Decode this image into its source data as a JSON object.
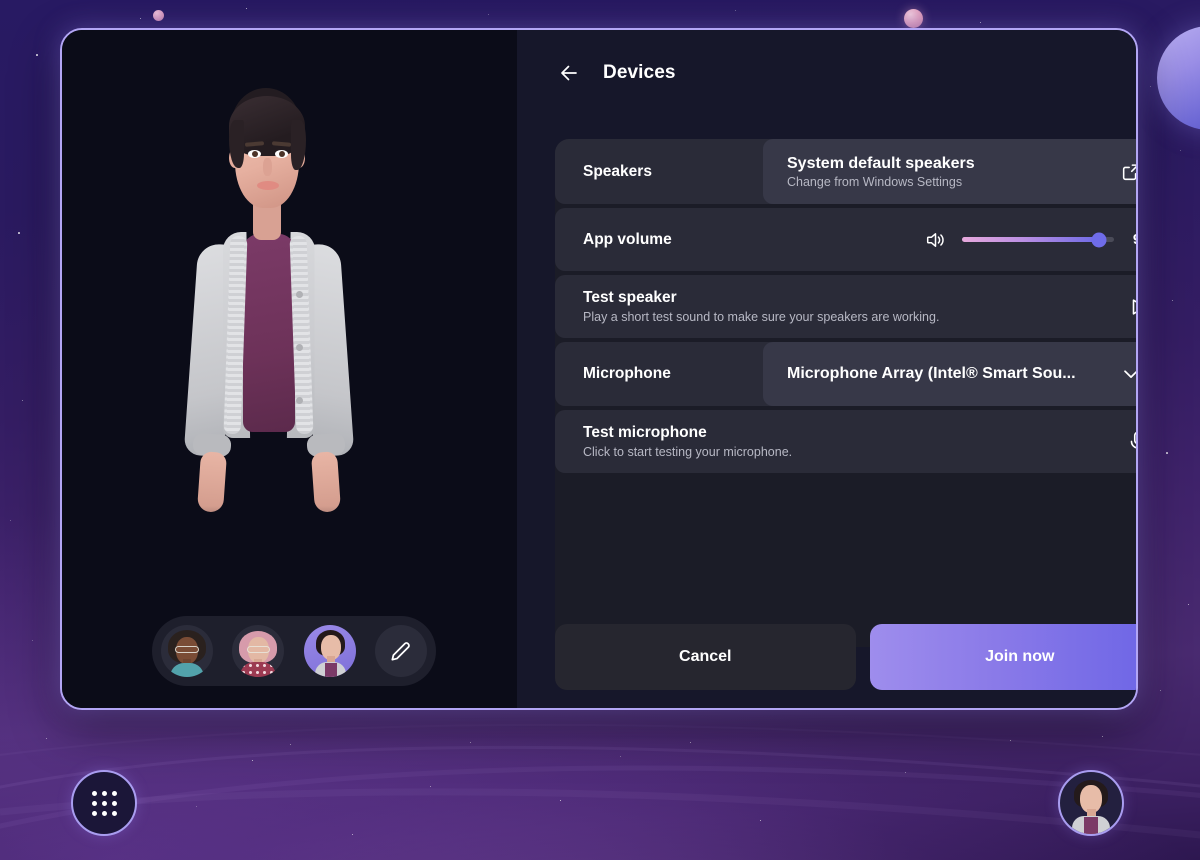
{
  "window": {
    "accent_purple": "#8a7ae8",
    "border_color": "#b3a6f5"
  },
  "stage": {
    "avatar_alt": "3D avatar preview",
    "picker": {
      "avatars": [
        {
          "name": "avatar-option-1",
          "selected": false
        },
        {
          "name": "avatar-option-2",
          "selected": false
        },
        {
          "name": "avatar-option-3",
          "selected": true
        }
      ],
      "edit_icon": "pencil-icon"
    }
  },
  "settings": {
    "back_icon": "arrow-left-icon",
    "title": "Devices",
    "rows": {
      "speakers": {
        "label": "Speakers",
        "value": "System default speakers",
        "description": "Change from Windows Settings",
        "action_icon": "external-link-icon"
      },
      "app_volume": {
        "label": "App volume",
        "icon": "speaker-volume-icon",
        "value": 9,
        "min": 0,
        "max": 10,
        "percent": 90
      },
      "test_speaker": {
        "title": "Test speaker",
        "description": "Play a short test sound to make sure your speakers are working.",
        "action_icon": "play-icon"
      },
      "microphone": {
        "label": "Microphone",
        "value": "Microphone Array (Intel® Smart Sou...",
        "action_icon": "chevron-down-icon"
      },
      "test_microphone": {
        "title": "Test microphone",
        "description": "Click to start testing your microphone.",
        "action_icon": "microphone-test-icon"
      }
    },
    "footer": {
      "cancel_label": "Cancel",
      "join_label": "Join now"
    }
  },
  "taskbar": {
    "app_launcher_icon": "grid-dots-icon",
    "user_avatar_icon": "user-avatar-icon"
  }
}
